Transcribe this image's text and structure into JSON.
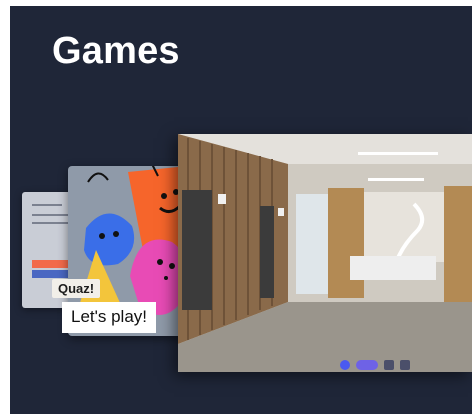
{
  "section": {
    "title": "Games"
  },
  "quiz_card": {
    "tag": "Quaz!",
    "caption": "Let's play!"
  },
  "colors": {
    "background": "#1f2638",
    "title_text": "#ffffff",
    "orange_blob": "#f6652b",
    "pink_blob": "#e84bb5",
    "yellow_blob": "#f3c53b",
    "blue_blob": "#3a6ee8"
  }
}
